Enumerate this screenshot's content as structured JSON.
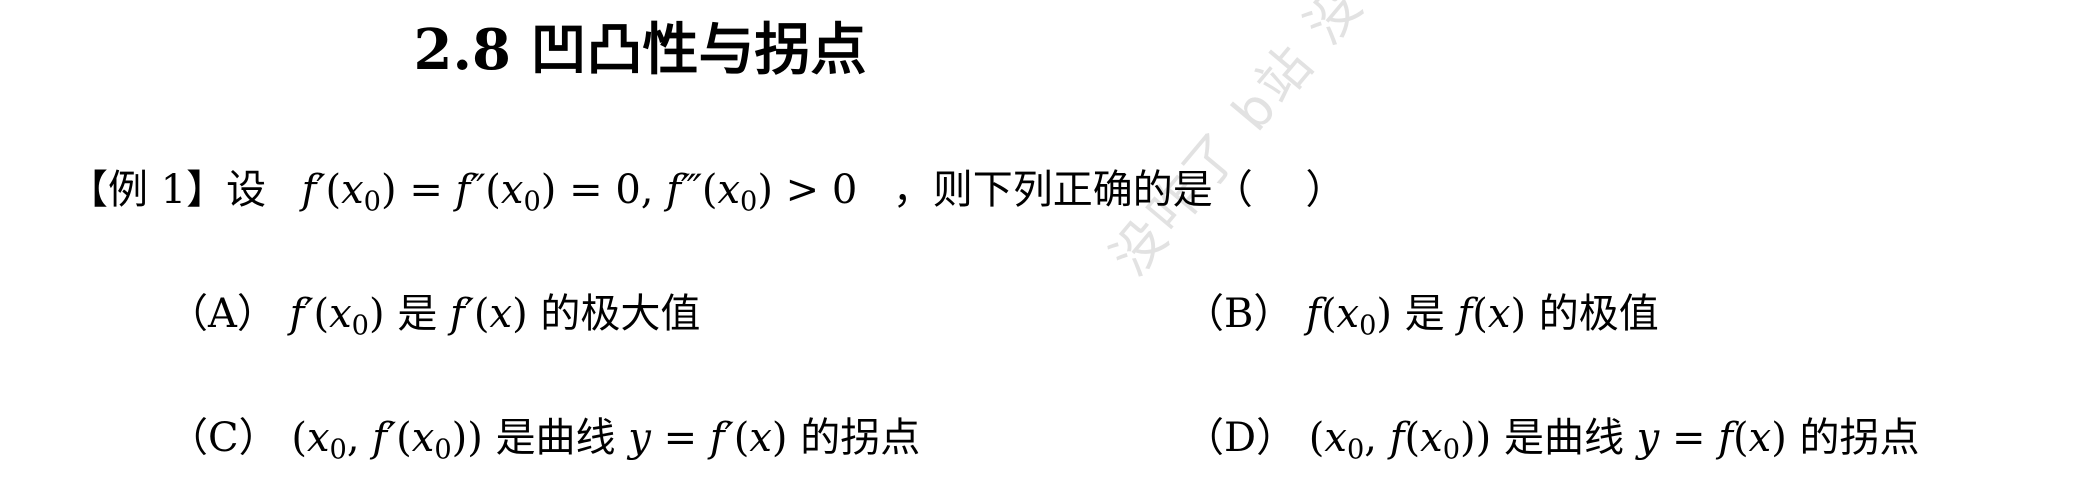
{
  "title": "2.8 凹凸性与拐点",
  "question": {
    "prefix": "【例 1】设",
    "f1": "f′",
    "f2": "f″",
    "f3": "f‴",
    "x": "x",
    "zero_sub": "0",
    "eq": "=",
    "zero": "0",
    "comma": ",",
    "gt": ">",
    "suffix": "，则下列正确的是（　 ）"
  },
  "options": {
    "A": {
      "label": "（A）",
      "text1": "是",
      "text2": "的极大值"
    },
    "B": {
      "label": "（B）",
      "text1": "是",
      "text2": "的极值"
    },
    "C": {
      "label": "（C）",
      "text1": "是曲线",
      "text2": "的拐点"
    },
    "D": {
      "label": "（D）",
      "text1": "是曲线",
      "text2": "的拐点"
    }
  },
  "math": {
    "f": "f",
    "fp": "f′",
    "x": "x",
    "y": "y",
    "sub0": "0",
    "lp": "(",
    "rp": ")",
    "rpp": "))",
    "comma": ",",
    "eq": "="
  },
  "watermark": "没咋了 b站 没咋了"
}
